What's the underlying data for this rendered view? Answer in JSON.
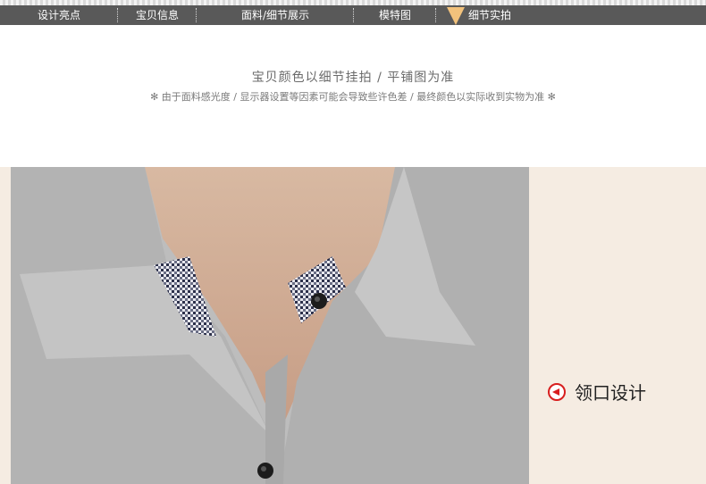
{
  "nav": {
    "items": [
      {
        "label": "设计亮点"
      },
      {
        "label": "宝贝信息"
      },
      {
        "label": "面料/细节展示"
      },
      {
        "label": "模特图"
      },
      {
        "label": "细节实拍"
      }
    ],
    "active_index": 4,
    "active_color": "#f2c27c",
    "bar_color": "#595959"
  },
  "section": {
    "title": "宝贝颜色以细节挂拍 / 平铺图为准",
    "notice": "✻ 由于面料感光度 / 显示器设置等因素可能会导致些许色差 / 最终颜色以实际收到实物为准 ✻"
  },
  "detail": {
    "caption": "领口设计",
    "caption_icon": "left-arrow-circle-icon",
    "photo_subject": "collar-photo",
    "panel_color": "#f5ece2"
  }
}
